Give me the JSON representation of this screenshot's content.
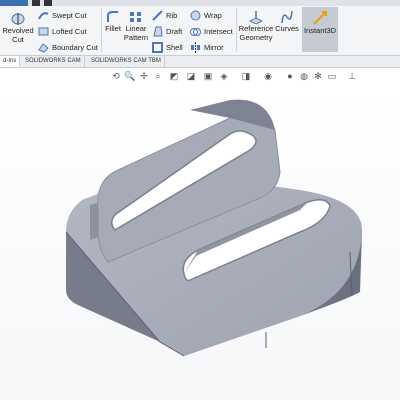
{
  "ribbon": {
    "revolved_cut": {
      "line1": "Revolved",
      "line2": "Cut"
    },
    "swept_cut": "Swept Cut",
    "lofted_cut": "Lofted Cut",
    "boundary_cut": "Boundary Cut",
    "fillet": "Fillet",
    "linear_pattern": {
      "line1": "Linear",
      "line2": "Pattern"
    },
    "rib": "Rib",
    "draft": "Draft",
    "shell": "Shell",
    "wrap": "Wrap",
    "intersect": "Intersect",
    "mirror": "Mirror",
    "reference_geometry": {
      "line1": "Reference",
      "line2": "Geometry"
    },
    "curves": "Curves",
    "instant3d": "Instant3D"
  },
  "tabs": [
    {
      "label": "d-Ins"
    },
    {
      "label": "SOLIDWORKS CAM"
    },
    {
      "label": "SOLIDWORKS CAM TBM"
    }
  ],
  "view_toolbar_icons": [
    "zoom-to-fit-icon",
    "zoom-to-area-icon",
    "previous-view-icon",
    "section-view-icon",
    "view-orientation-icon",
    "display-style-icon",
    "hide-show-items-icon",
    "edit-appearance-icon",
    "apply-scene-icon",
    "view-settings-icon"
  ],
  "colors": {
    "accent": "#1f6fbf",
    "part_face": "#a6aab6",
    "ribbon_bg": "#f4f5f7"
  }
}
